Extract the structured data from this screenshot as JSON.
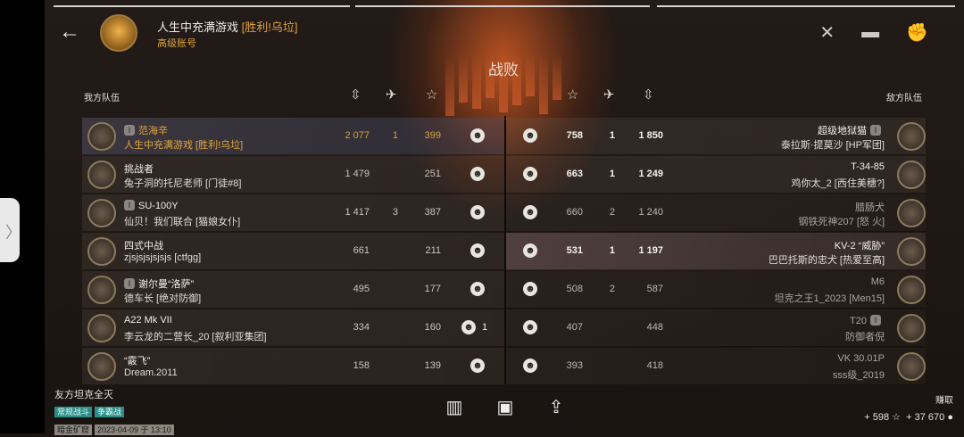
{
  "header": {
    "player_name": "人生中充满游戏",
    "clan": "[胜利!乌垃]",
    "account_type": "高级账号",
    "result": "战败",
    "back_icon": "back-arrow-icon",
    "icons": [
      "crossed-swords-icon",
      "tank-icon",
      "fist-icon"
    ]
  },
  "allies_label": "我方队伍",
  "enemies_label": "敌方队伍",
  "stat_icons": [
    "damage-icon",
    "kills-icon",
    "xp-star-icon"
  ],
  "allies": [
    {
      "tank": "范海辛",
      "badge": "I",
      "nick": "人生中充满游戏 [胜利!乌垃]",
      "damage": "2 077",
      "kills": "1",
      "xp": "399",
      "me": true
    },
    {
      "tank": "挑战者",
      "badge": "",
      "nick": "兔子洞的托尼老师 [门徒#8]",
      "damage": "1 479",
      "kills": "",
      "xp": "251"
    },
    {
      "tank": "SU-100Y",
      "badge": "I",
      "nick": "仙贝！我们联合 [猫娘女仆]",
      "damage": "1 417",
      "kills": "3",
      "xp": "387"
    },
    {
      "tank": "四式中战",
      "badge": "",
      "nick": "zjsjsjsjsjsjs [ctfgg]",
      "damage": "661",
      "kills": "",
      "xp": "211"
    },
    {
      "tank": "谢尔曼“洛萨”",
      "badge": "I",
      "nick": "德车长 [绝对防御]",
      "damage": "495",
      "kills": "",
      "xp": "177"
    },
    {
      "tank": "A22 Mk VII",
      "badge": "",
      "nick": "李云龙的二营长_20 [叙利亚集团]",
      "damage": "334",
      "kills": "",
      "xp": "160",
      "smile_count": "1"
    },
    {
      "tank": "“霰飞”",
      "badge": "",
      "nick": "Dream.2011",
      "damage": "158",
      "kills": "",
      "xp": "139"
    }
  ],
  "enemies": [
    {
      "tank": "超级地狱猫",
      "badge": "I",
      "nick": "泰拉斯·提莫沙 [HP军团]",
      "xp": "758",
      "kills": "1",
      "damage": "1 850",
      "alive": true
    },
    {
      "tank": "T-34-85",
      "badge": "",
      "nick": "鸡你太_2 [西住美穗?]",
      "xp": "663",
      "kills": "1",
      "damage": "1 249",
      "alive": true
    },
    {
      "tank": "腊肠犬",
      "badge": "",
      "nick": "钢铁死神207 [怒 火]",
      "xp": "660",
      "kills": "2",
      "damage": "1 240",
      "alive": false
    },
    {
      "tank": "KV-2 “威胁”",
      "badge": "",
      "nick": "巴巴托斯的忠犬 [热爱至高]",
      "xp": "531",
      "kills": "1",
      "damage": "1 197",
      "alive": true
    },
    {
      "tank": "M6",
      "badge": "",
      "nick": "坦克之王1_2023 [Men15]",
      "xp": "508",
      "kills": "2",
      "damage": "587",
      "alive": false
    },
    {
      "tank": "T20",
      "badge": "I",
      "nick": "防御者倪",
      "xp": "407",
      "kills": "",
      "damage": "448",
      "alive": false
    },
    {
      "tank": "VK 30.01P",
      "badge": "",
      "nick": "sss级_2019",
      "xp": "393",
      "kills": "",
      "damage": "418",
      "alive": false
    }
  ],
  "footer": {
    "summary": "友方坦克全灭",
    "mode": "常规战斗",
    "type": "争霸战",
    "map": "暗金矿窟",
    "date": "2023-04-09 于 13:10",
    "earn_label": "赚取",
    "xp_earned": "+ 598",
    "credits_earned": "+ 37 670"
  }
}
